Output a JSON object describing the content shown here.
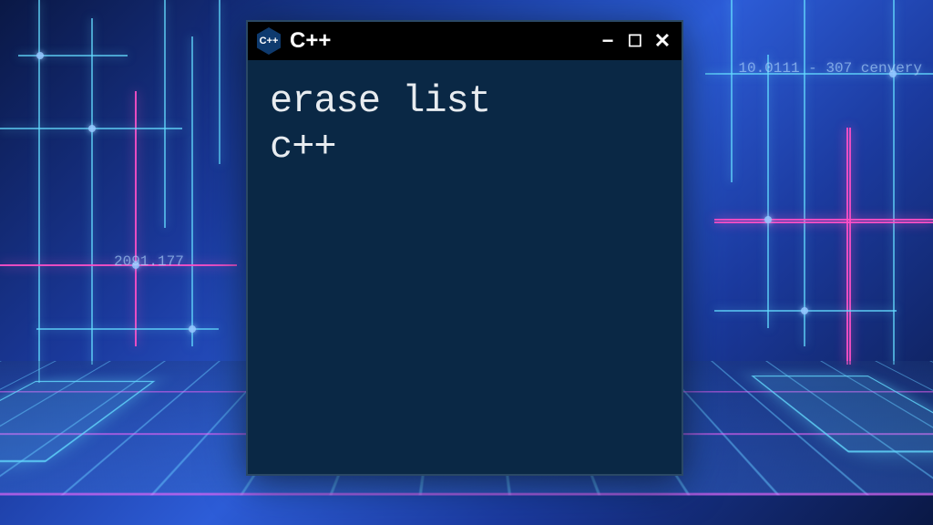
{
  "window": {
    "app_name": "C++",
    "icon_text": "C++",
    "controls": {
      "minimize": "−",
      "maximize": "☐",
      "close": "✕"
    }
  },
  "terminal": {
    "line1": "erase list",
    "line2": "c++"
  },
  "background": {
    "text1": "2091.177",
    "text2": "10.0111 - 307  cenvery"
  }
}
